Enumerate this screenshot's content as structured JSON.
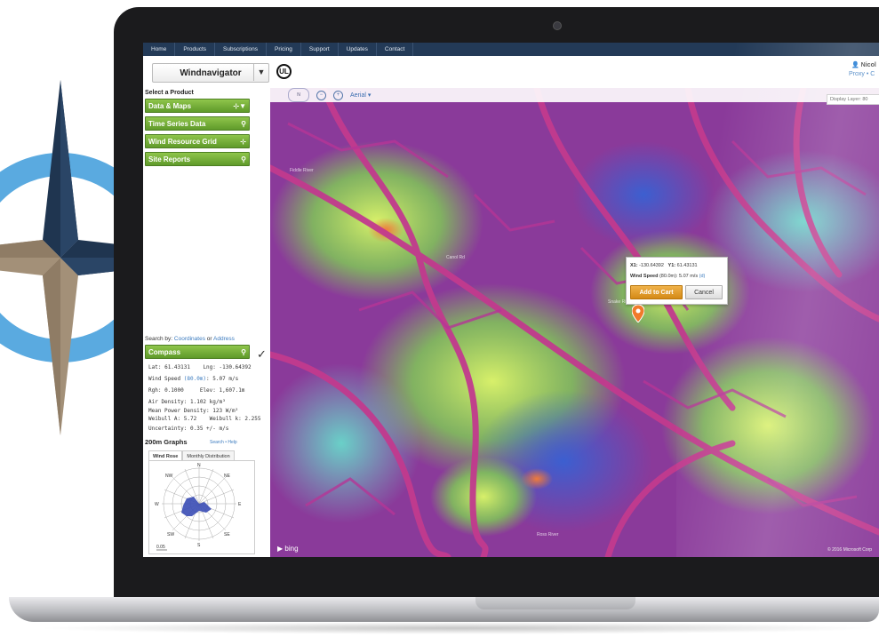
{
  "nav": {
    "items": [
      "Home",
      "Products",
      "Subscriptions",
      "Pricing",
      "Support",
      "Updates",
      "Contact"
    ]
  },
  "header": {
    "product_select": "Windnavigator",
    "select_caret": "▼",
    "logo_text": "UL",
    "user_name": "Nicol",
    "user_links": "Proxy • C"
  },
  "sidebar": {
    "select_label": "Select a Product",
    "products": [
      {
        "label": "Data & Maps",
        "icon": "cart-add-icon"
      },
      {
        "label": "Time Series Data",
        "icon": "map-pin-icon"
      },
      {
        "label": "Wind Resource Grid",
        "icon": "cart-add-icon"
      },
      {
        "label": "Site Reports",
        "icon": "map-pin-icon"
      }
    ],
    "search_by_prefix": "Search by:",
    "search_by_coords": "Coordinates",
    "search_by_or": "or",
    "search_by_address": "Address",
    "compass_label": "Compass",
    "info": {
      "lat_label": "Lat:",
      "lat": "61.43131",
      "lng_label": "Lng:",
      "lng": "-130.64392",
      "wind_speed_label": "Wind Speed",
      "wind_speed_height": "(80.0m)",
      "wind_speed": "5.07 m/s",
      "rgh_label": "Rgh:",
      "rgh": "0.1000",
      "elev_label": "Elev:",
      "elev": "1,607.1m",
      "air_density_label": "Air Density:",
      "air_density": "1.102 kg/m³",
      "mpd_label": "Mean Power Density:",
      "mpd": "123 W/m²",
      "weibull_a_label": "Weibull A:",
      "weibull_a": "5.72",
      "weibull_k_label": "Weibull k:",
      "weibull_k": "2.255",
      "uncertainty_label": "Uncertainty:",
      "uncertainty": "0.35 +/- m/s"
    },
    "graphs_title": "200m Graphs",
    "graphs_links": "Search • Help",
    "tabs": [
      "Wind Rose",
      "Monthly Distribution"
    ],
    "rose": {
      "dirs": [
        "N",
        "NE",
        "E",
        "SE",
        "S",
        "SW",
        "W",
        "NW"
      ],
      "scale_label": "0.05"
    }
  },
  "map": {
    "view_label": "Aerial ▾",
    "nav_label": "N",
    "display_layer": "Display Layer: 80",
    "bing": "bing",
    "copyright": "© 2016 Microsoft Corp",
    "places": [
      "Fiddle River",
      "Canol Rd",
      "Snake River",
      "Ross River"
    ]
  },
  "popup": {
    "x_label": "X1:",
    "x": "-130.64392",
    "y_label": "Y1:",
    "y": "61.43131",
    "wind_label": "Wind Speed",
    "wind_height": "(80.0m):",
    "wind": "5.07 m/s",
    "wind_link": "(d)",
    "add_to_cart": "Add to Cart",
    "cancel": "Cancel"
  },
  "colors": {
    "nav_bg": "#233a57",
    "green_button": "#6ca833",
    "orange_button": "#e29a2a",
    "link": "#3b7bbf",
    "map_magenta": "#b0378f",
    "map_green": "#8fd24a"
  }
}
